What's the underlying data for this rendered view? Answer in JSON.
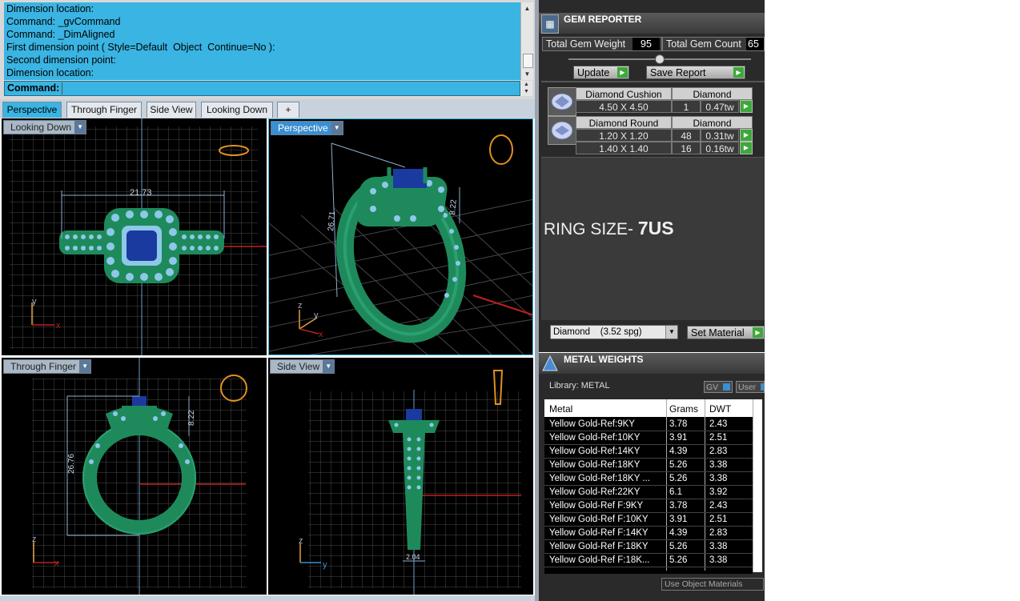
{
  "command_log": {
    "lines": [
      "Dimension location:",
      "Command: _gvCommand",
      "Command: _DimAligned",
      "First dimension point ( Style=Default  Object  Continue=No ):",
      "Second dimension point:",
      "Dimension location:"
    ],
    "prompt": "Command:"
  },
  "tabs": [
    {
      "label": "Perspective",
      "active": true
    },
    {
      "label": "Through Finger",
      "active": false
    },
    {
      "label": "Side View",
      "active": false
    },
    {
      "label": "Looking Down",
      "active": false
    },
    {
      "label": "+",
      "active": false
    }
  ],
  "viewports": {
    "top_left": {
      "label": "Looking Down",
      "dimension": "21.73",
      "axes": [
        "y",
        "x"
      ]
    },
    "top_right": {
      "label": "Perspective",
      "dimensions": [
        "26.71",
        "8.22"
      ],
      "axes": [
        "z",
        "y",
        "x"
      ]
    },
    "bottom_left": {
      "label": "Through Finger",
      "dimensions": [
        "26.76",
        "8.22"
      ],
      "axes": [
        "z",
        "x"
      ]
    },
    "bottom_right": {
      "label": "Side View",
      "dimension": "2.04",
      "axes": [
        "z",
        "y"
      ]
    }
  },
  "gem_reporter": {
    "title": "GEM REPORTER",
    "total_weight_label": "Total Gem Weight",
    "total_weight_value": "95",
    "total_count_label": "Total Gem Count",
    "total_count_value": "65",
    "update_label": "Update",
    "save_label": "Save Report",
    "groups": [
      {
        "name": "Diamond Cushion",
        "material": "Diamond",
        "rows": [
          {
            "size": "4.50 X 4.50",
            "count": "1",
            "weight": "0.47tw"
          }
        ]
      },
      {
        "name": "Diamond Round",
        "material": "Diamond",
        "rows": [
          {
            "size": "1.20 X 1.20",
            "count": "48",
            "weight": "0.31tw"
          },
          {
            "size": "1.40 X 1.40",
            "count": "16",
            "weight": "0.16tw"
          }
        ]
      }
    ],
    "ring_size_prefix": "RING SIZE- ",
    "ring_size_value": "7US",
    "material_select": "Diamond    (3.52 spg)",
    "set_material_label": "Set Material"
  },
  "metal_weights": {
    "title": "METAL WEIGHTS",
    "library": "Library: METAL",
    "gv_label": "GV",
    "user_label": "User",
    "columns": [
      "Metal",
      "Grams",
      "DWT"
    ],
    "rows": [
      [
        "Yellow Gold-Ref:9KY",
        "3.78",
        "2.43"
      ],
      [
        "Yellow Gold-Ref:10KY",
        "3.91",
        "2.51"
      ],
      [
        "Yellow Gold-Ref:14KY",
        "4.39",
        "2.83"
      ],
      [
        "Yellow Gold-Ref:18KY",
        "5.26",
        "3.38"
      ],
      [
        "Yellow Gold-Ref:18KY ...",
        "5.26",
        "3.38"
      ],
      [
        "Yellow Gold-Ref:22KY",
        "6.1",
        "3.92"
      ],
      [
        "Yellow Gold-Ref F:9KY",
        "3.78",
        "2.43"
      ],
      [
        "Yellow Gold-Ref F:10KY",
        "3.91",
        "2.51"
      ],
      [
        "Yellow Gold-Ref F:14KY",
        "4.39",
        "2.83"
      ],
      [
        "Yellow Gold-Ref F:18KY",
        "5.26",
        "3.38"
      ],
      [
        "Yellow Gold-Ref F:18K...",
        "5.26",
        "3.38"
      ]
    ],
    "use_object_label": "Use Object Materials"
  }
}
